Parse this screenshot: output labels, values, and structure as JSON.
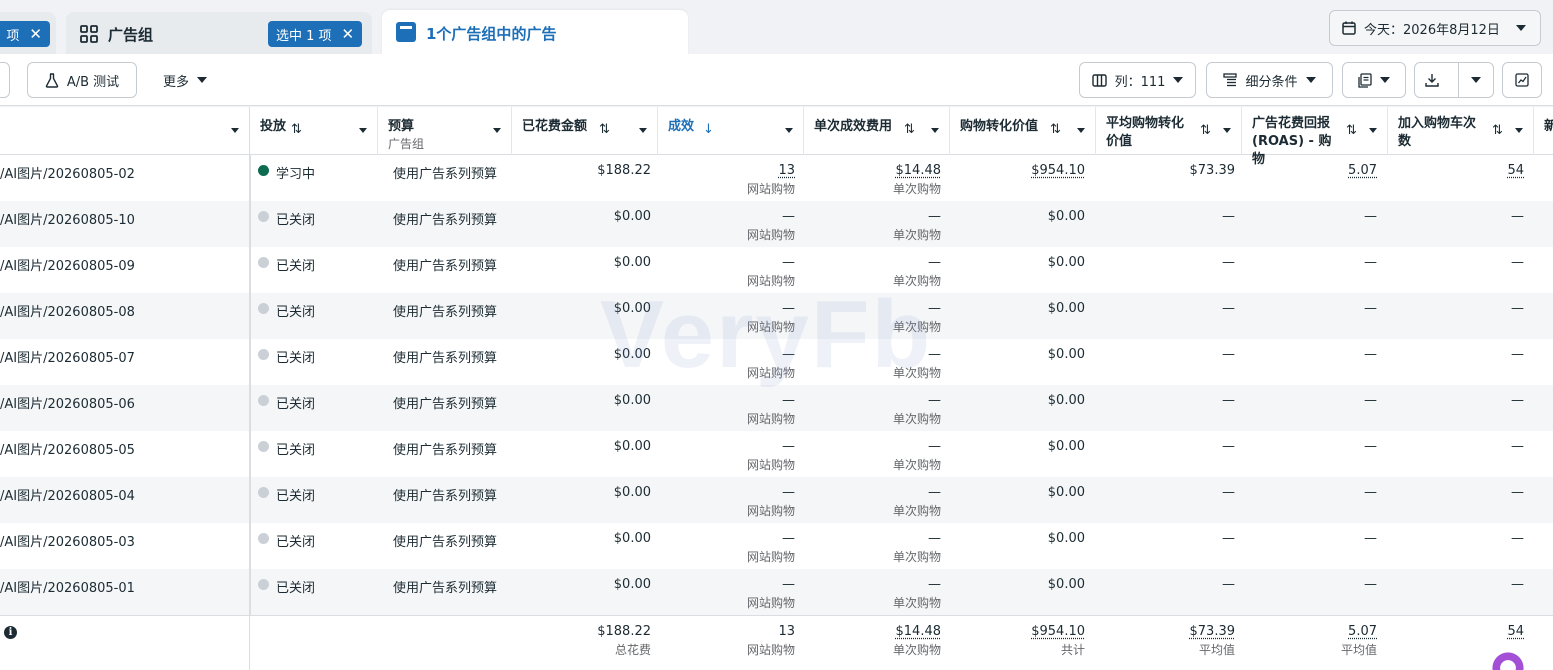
{
  "tabs": {
    "tab1": {
      "selected_label": "项"
    },
    "tab2": {
      "label": "广告组",
      "selected_label": "选中 1 项"
    },
    "tab3": {
      "label": "1个广告组中的广告"
    }
  },
  "date_picker": {
    "label": "今天：2026年8月12日"
  },
  "toolbar": {
    "ab_test": "A/B 测试",
    "more": "更多",
    "columns": "列：111",
    "breakdown": "细分条件"
  },
  "columns": {
    "delivery": "投放",
    "budget": "预算",
    "budget_sub": "广告组",
    "spent": "已花费金额",
    "results": "成效",
    "cost_per_result": "单次成效费用",
    "purchase_value": "购物转化价值",
    "avg_purchase_value": "平均购物转化价值",
    "roas": "广告花费回报 (ROAS) - 购物",
    "add_to_cart": "加入购物车次数",
    "next": "新"
  },
  "rows": [
    {
      "name": "/AI图片/20260805-02",
      "delivery": "学习中",
      "status_color": "#0d6b4f",
      "budget": "使用广告系列预算",
      "spent": "$188.22",
      "results": "13",
      "results_sub": "网站购物",
      "cpr": "$14.48",
      "cpr_sub": "单次购物",
      "value": "$954.10",
      "avg": "$73.39",
      "roas": "5.07",
      "atc": "54"
    },
    {
      "name": "/AI图片/20260805-10",
      "delivery": "已关闭",
      "status_color": "#cbd0d6",
      "budget": "使用广告系列预算",
      "spent": "$0.00",
      "results": "—",
      "results_sub": "网站购物",
      "cpr": "—",
      "cpr_sub": "单次购物",
      "value": "$0.00",
      "avg": "—",
      "roas": "—",
      "atc": "—"
    },
    {
      "name": "/AI图片/20260805-09",
      "delivery": "已关闭",
      "status_color": "#cbd0d6",
      "budget": "使用广告系列预算",
      "spent": "$0.00",
      "results": "—",
      "results_sub": "网站购物",
      "cpr": "—",
      "cpr_sub": "单次购物",
      "value": "$0.00",
      "avg": "—",
      "roas": "—",
      "atc": "—"
    },
    {
      "name": "/AI图片/20260805-08",
      "delivery": "已关闭",
      "status_color": "#cbd0d6",
      "budget": "使用广告系列预算",
      "spent": "$0.00",
      "results": "—",
      "results_sub": "网站购物",
      "cpr": "—",
      "cpr_sub": "单次购物",
      "value": "$0.00",
      "avg": "—",
      "roas": "—",
      "atc": "—"
    },
    {
      "name": "/AI图片/20260805-07",
      "delivery": "已关闭",
      "status_color": "#cbd0d6",
      "budget": "使用广告系列预算",
      "spent": "$0.00",
      "results": "—",
      "results_sub": "网站购物",
      "cpr": "—",
      "cpr_sub": "单次购物",
      "value": "$0.00",
      "avg": "—",
      "roas": "—",
      "atc": "—"
    },
    {
      "name": "/AI图片/20260805-06",
      "delivery": "已关闭",
      "status_color": "#cbd0d6",
      "budget": "使用广告系列预算",
      "spent": "$0.00",
      "results": "—",
      "results_sub": "网站购物",
      "cpr": "—",
      "cpr_sub": "单次购物",
      "value": "$0.00",
      "avg": "—",
      "roas": "—",
      "atc": "—"
    },
    {
      "name": "/AI图片/20260805-05",
      "delivery": "已关闭",
      "status_color": "#cbd0d6",
      "budget": "使用广告系列预算",
      "spent": "$0.00",
      "results": "—",
      "results_sub": "网站购物",
      "cpr": "—",
      "cpr_sub": "单次购物",
      "value": "$0.00",
      "avg": "—",
      "roas": "—",
      "atc": "—"
    },
    {
      "name": "/AI图片/20260805-04",
      "delivery": "已关闭",
      "status_color": "#cbd0d6",
      "budget": "使用广告系列预算",
      "spent": "$0.00",
      "results": "—",
      "results_sub": "网站购物",
      "cpr": "—",
      "cpr_sub": "单次购物",
      "value": "$0.00",
      "avg": "—",
      "roas": "—",
      "atc": "—"
    },
    {
      "name": "/AI图片/20260805-03",
      "delivery": "已关闭",
      "status_color": "#cbd0d6",
      "budget": "使用广告系列预算",
      "spent": "$0.00",
      "results": "—",
      "results_sub": "网站购物",
      "cpr": "—",
      "cpr_sub": "单次购物",
      "value": "$0.00",
      "avg": "—",
      "roas": "—",
      "atc": "—"
    },
    {
      "name": "/AI图片/20260805-01",
      "delivery": "已关闭",
      "status_color": "#cbd0d6",
      "budget": "使用广告系列预算",
      "spent": "$0.00",
      "results": "—",
      "results_sub": "网站购物",
      "cpr": "—",
      "cpr_sub": "单次购物",
      "value": "$0.00",
      "avg": "—",
      "roas": "—",
      "atc": "—"
    }
  ],
  "totals": {
    "spent": "$188.22",
    "spent_sub": "总花费",
    "results": "13",
    "results_sub": "网站购物",
    "cpr": "$14.48",
    "cpr_sub": "单次购物",
    "value": "$954.10",
    "value_sub": "共计",
    "avg": "$73.39",
    "avg_sub": "平均值",
    "roas": "5.07",
    "roas_sub": "平均值",
    "atc": "54"
  },
  "watermark": "VeryFb"
}
